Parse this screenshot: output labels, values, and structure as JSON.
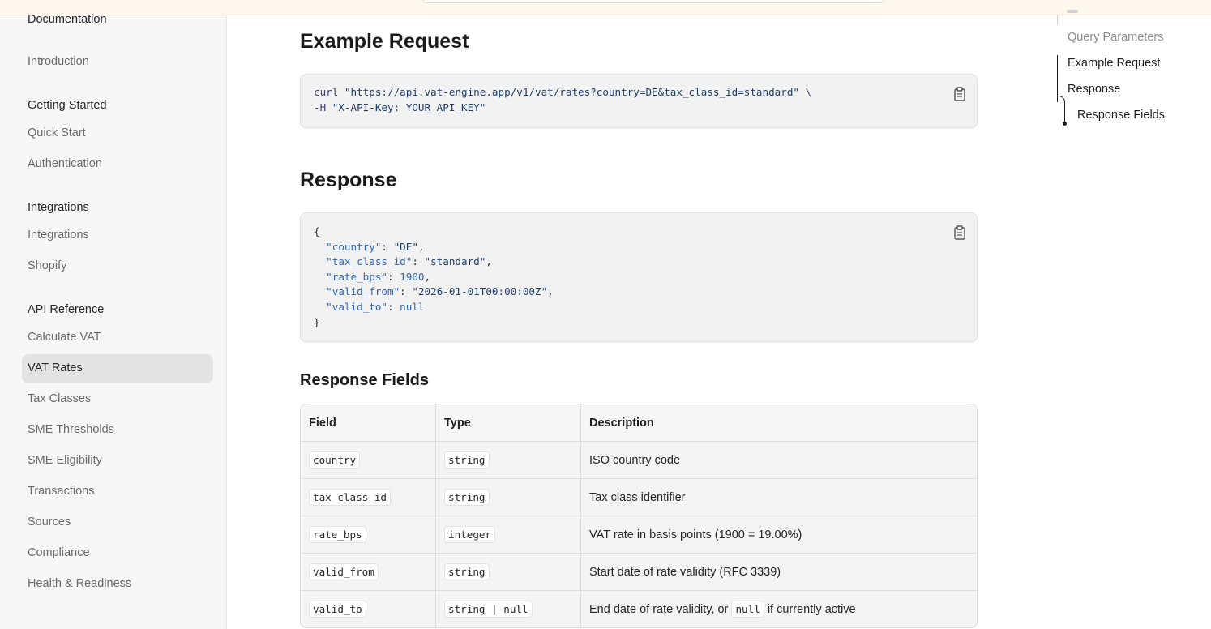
{
  "sidebar": {
    "documentation": "Documentation",
    "introduction": "Introduction",
    "groups": [
      {
        "title": "Getting Started",
        "items": [
          "Quick Start",
          "Authentication"
        ]
      },
      {
        "title": "Integrations",
        "items": [
          "Integrations",
          "Shopify"
        ]
      },
      {
        "title": "API Reference",
        "items": [
          "Calculate VAT",
          "VAT Rates",
          "Tax Classes",
          "SME Thresholds",
          "SME Eligibility",
          "Transactions",
          "Sources",
          "Compliance",
          "Health & Readiness"
        ]
      }
    ],
    "active_item": "VAT Rates"
  },
  "main": {
    "example_request_title": "Example Request",
    "request": {
      "cmd": "curl",
      "url": "\"https://api.vat-engine.app/v1/vat/rates?country=DE&tax_class_id=standard\"",
      "continuation": " \\",
      "header_flag": "-H",
      "header_value": "\"X-API-Key: YOUR_API_KEY\""
    },
    "response_title": "Response",
    "response_json": {
      "open": "{",
      "lines": [
        {
          "key": "\"country\"",
          "value": "\"DE\"",
          "value_kind": "string",
          "comma": ","
        },
        {
          "key": "\"tax_class_id\"",
          "value": "\"standard\"",
          "value_kind": "string",
          "comma": ","
        },
        {
          "key": "\"rate_bps\"",
          "value": "1900",
          "value_kind": "number",
          "comma": ","
        },
        {
          "key": "\"valid_from\"",
          "value": "\"2026-01-01T00:00:00Z\"",
          "value_kind": "string",
          "comma": ","
        },
        {
          "key": "\"valid_to\"",
          "value": "null",
          "value_kind": "literal",
          "comma": ""
        }
      ],
      "close": "}"
    },
    "fields_title": "Response Fields",
    "fields_table": {
      "headers": [
        "Field",
        "Type",
        "Description"
      ],
      "rows": [
        {
          "field": "country",
          "type": "string",
          "description": "ISO country code"
        },
        {
          "field": "tax_class_id",
          "type": "string",
          "description": "Tax class identifier"
        },
        {
          "field": "rate_bps",
          "type": "integer",
          "description": "VAT rate in basis points (1900 = 19.00%)"
        },
        {
          "field": "valid_from",
          "type": "string",
          "description": "Start date of rate validity (RFC 3339)"
        },
        {
          "field": "valid_to",
          "type": "string | null",
          "description_before": "End date of rate validity, or",
          "description_code": "null",
          "description_after": "if currently active"
        }
      ]
    }
  },
  "toc": {
    "items": [
      "Query Parameters",
      "Example Request",
      "Response",
      "Response Fields"
    ],
    "active": "Example Request"
  },
  "icons": {
    "copy": "clipboard-icon"
  },
  "colors": {
    "sidebar_bg": "#f7f7f7",
    "active_bg": "#e3e3e3",
    "code_bg": "#f2f2f2",
    "json_key": "#2e67b4",
    "topbar_bg": "#fdf8ee"
  }
}
